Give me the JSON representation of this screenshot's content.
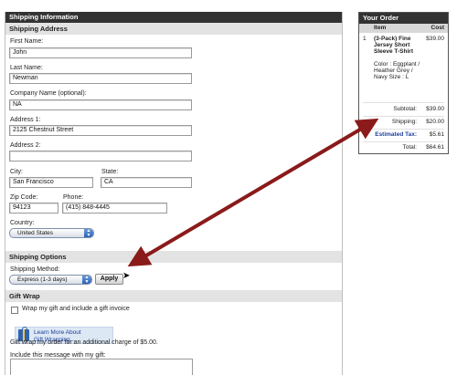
{
  "main": {
    "title": "Shipping Information",
    "shipping_address": {
      "heading": "Shipping Address",
      "first_name": {
        "label": "First Name:",
        "value": "John"
      },
      "last_name": {
        "label": "Last Name:",
        "value": "Newman"
      },
      "company": {
        "label": "Company Name (optional):",
        "value": "NA"
      },
      "address1": {
        "label": "Address 1:",
        "value": "2125 Chestnut Street"
      },
      "address2": {
        "label": "Address 2:",
        "value": ""
      },
      "city": {
        "label": "City:",
        "value": "San Francisco"
      },
      "state": {
        "label": "State:",
        "value": "CA"
      },
      "zip": {
        "label": "Zip Code:",
        "value": "94123"
      },
      "phone": {
        "label": "Phone:",
        "value": "(415) 848-4445"
      },
      "country": {
        "label": "Country:",
        "value": "United States"
      }
    },
    "shipping_options": {
      "heading": "Shipping Options",
      "method_label": "Shipping Method:",
      "method_value": "Express (1-3 days)",
      "apply_label": "Apply"
    },
    "gift_wrap": {
      "heading": "Gift Wrap",
      "checkbox_label": "Wrap my gift and include a gift invoice",
      "learn_more_line1": "Learn More About",
      "learn_more_line2": "Gift Wrapping...",
      "charge_text": "Gift wrap my order for an additional charge of $5.00.",
      "message_label": "Include this message with my gift:"
    }
  },
  "order": {
    "title": "Your Order",
    "col_item": "Item",
    "col_cost": "Cost",
    "items": [
      {
        "qty": "1",
        "name": "(3-Pack) Fine Jersey Short Sleeve T-Shirt",
        "options": "Color : Eggplant / Heather Grey / Navy Size : L",
        "cost": "$39.00"
      }
    ],
    "subtotal_label": "Subtotal:",
    "subtotal": "$39.00",
    "shipping_label": "Shipping:",
    "shipping": "$20.00",
    "tax_label": "Estimated Tax:",
    "tax": "$5.61",
    "total_label": "Total:",
    "total": "$64.61"
  },
  "colors": {
    "header_bg": "#333333",
    "section_bg": "#e3e3e3",
    "arrow": "#8b1a1a",
    "link": "#1d3f9a"
  }
}
